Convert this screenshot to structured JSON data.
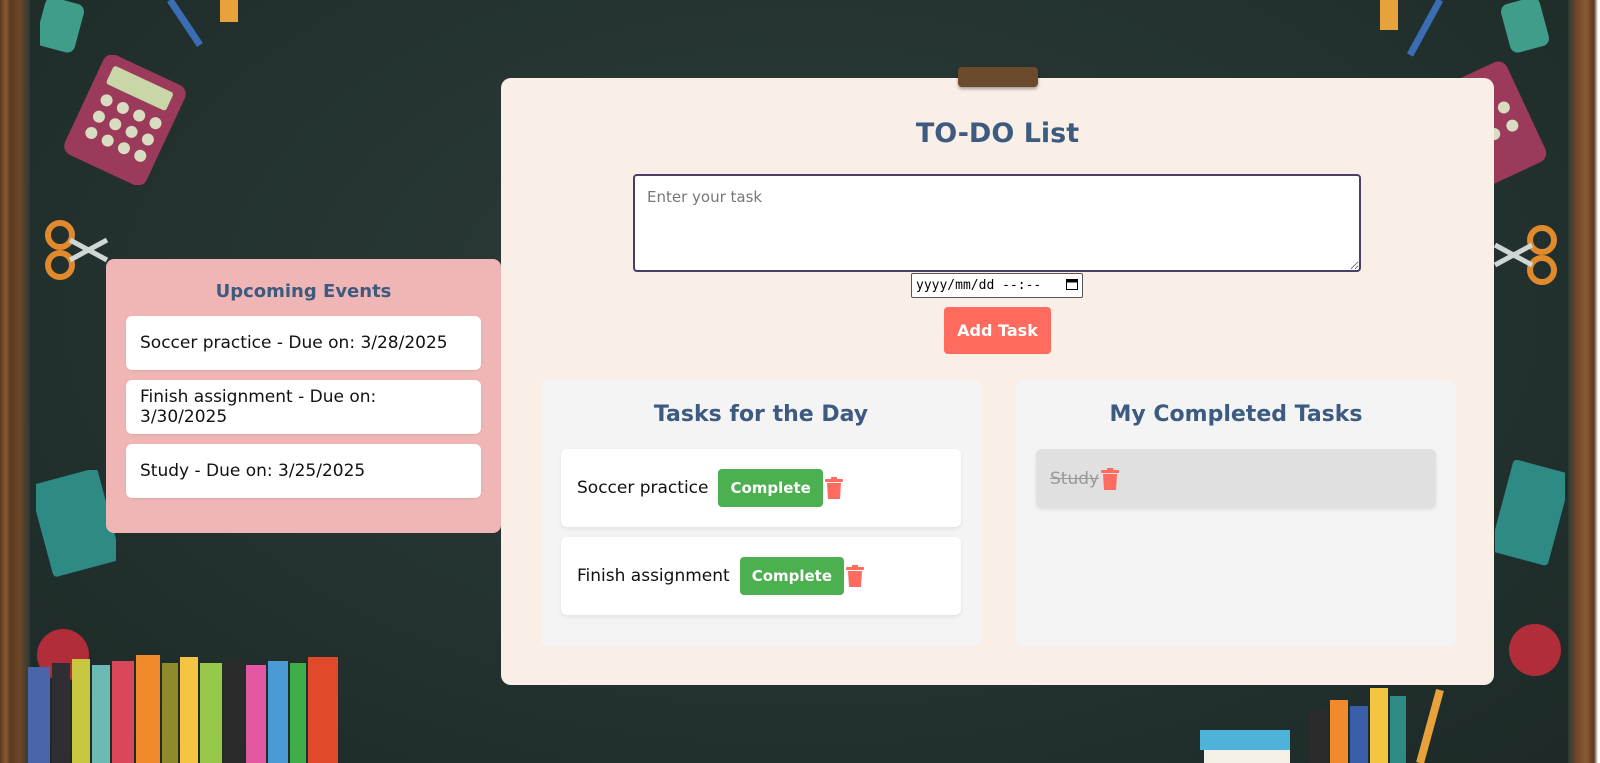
{
  "app": {
    "title": "TO-DO List",
    "input_placeholder": "Enter your task",
    "date_placeholder": "yyyy/mm/dd --:--",
    "add_button": "Add Task"
  },
  "events": {
    "title": "Upcoming Events",
    "items": [
      "Soccer practice - Due on: 3/28/2025",
      "Finish assignment - Due on: 3/30/2025",
      "Study - Due on: 3/25/2025"
    ]
  },
  "today": {
    "title": "Tasks for the Day",
    "complete_label": "Complete",
    "tasks": [
      "Soccer practice",
      "Finish assignment"
    ]
  },
  "completed": {
    "title": "My Completed Tasks",
    "tasks": [
      "Study"
    ]
  },
  "colors": {
    "accent": "#ff6b5e",
    "complete": "#4caf50",
    "heading": "#3d5a80",
    "events_panel": "#f0b6b6",
    "card": "#faefe6"
  },
  "icons": {
    "delete": "trash-icon",
    "date": "calendar-icon"
  }
}
